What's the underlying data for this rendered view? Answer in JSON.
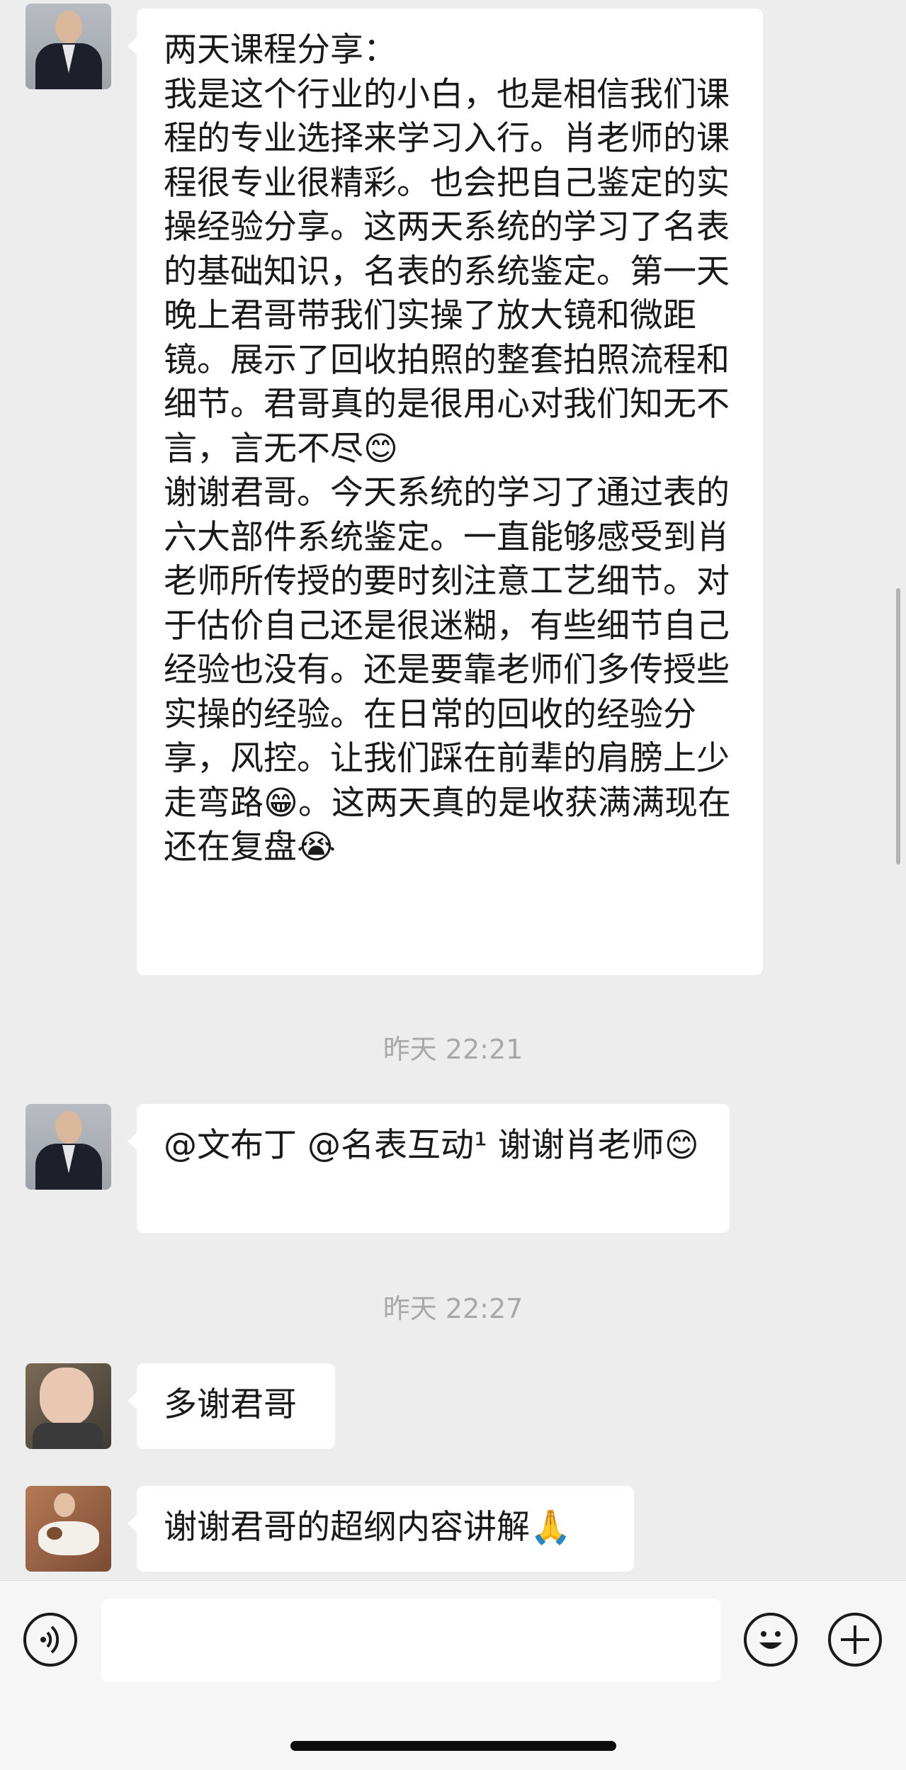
{
  "messages": [
    {
      "type": "text",
      "text": "两天课程分享：\n我是这个行业的小白，也是相信我们课程的专业选择来学习入行。肖老师的课程很专业很精彩。也会把自己鉴定的实操经验分享。这两天系统的学习了名表的基础知识，名表的系统鉴定。第一天晚上君哥带我们实操了放大镜和微距镜。展示了回收拍照的整套拍照流程和细节。君哥真的是很用心对我们知无不言，言无不尽😊\n谢谢君哥。今天系统的学习了通过表的六大部件系统鉴定。一直能够感受到肖老师所传授的要时刻注意工艺细节。对于估价自己还是很迷糊，有些细节自己经验也没有。还是要靠老师们多传授些实操的经验。在日常的回收的经验分享，风控。让我们踩在前辈的肩膀上少走弯路😁。这两天真的是收获满满现在还在复盘😭"
    },
    {
      "type": "time",
      "text": "昨天 22:21"
    },
    {
      "type": "text",
      "text": "@文布丁 @名表互动¹ 谢谢肖老师😊"
    },
    {
      "type": "time",
      "text": "昨天 22:27"
    },
    {
      "type": "text",
      "text": "多谢君哥"
    },
    {
      "type": "text",
      "text": "谢谢君哥的超纲内容讲解🙏"
    }
  ],
  "input": {
    "value": ""
  },
  "icons": {
    "voice": "voice-icon",
    "emoji": "emoji-icon",
    "plus": "plus-icon"
  }
}
